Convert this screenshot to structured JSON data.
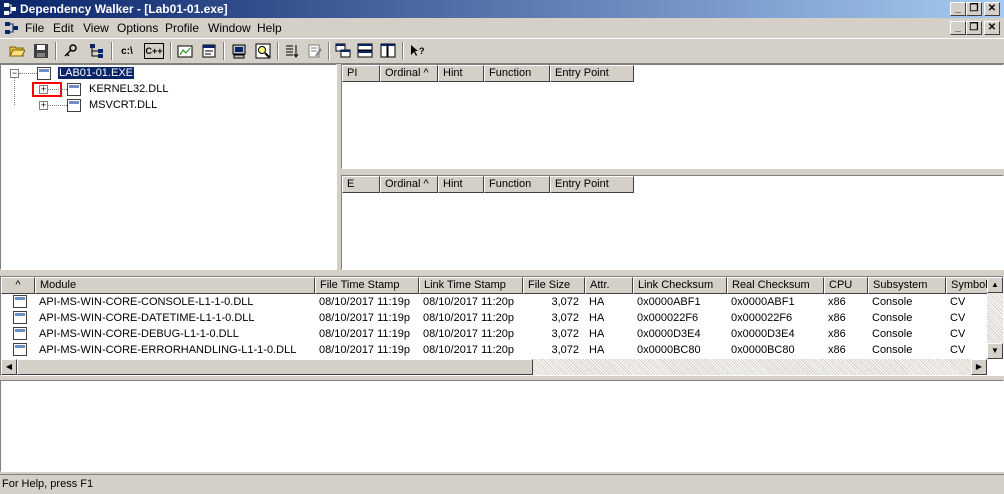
{
  "window": {
    "title": "Dependency Walker - [Lab01-01.exe]",
    "minimize_glyph": "_",
    "restore_glyph": "❐",
    "close_glyph": "✕"
  },
  "menu": [
    "File",
    "Edit",
    "View",
    "Options",
    "Profile",
    "Window",
    "Help"
  ],
  "toolbar": {
    "path_button": "c:\\",
    "cpp_button": "C++"
  },
  "tree": {
    "root": "LAB01-01.EXE",
    "children": [
      "KERNEL32.DLL",
      "MSVCRT.DLL"
    ]
  },
  "imports_panel": {
    "columns": [
      "PI",
      "Ordinal ^",
      "Hint",
      "Function",
      "Entry Point"
    ]
  },
  "exports_panel": {
    "columns": [
      "E",
      "Ordinal ^",
      "Hint",
      "Function",
      "Entry Point"
    ]
  },
  "module_list": {
    "columns": [
      "^",
      "Module",
      "File Time Stamp",
      "Link Time Stamp",
      "File Size",
      "Attr.",
      "Link Checksum",
      "Real Checksum",
      "CPU",
      "Subsystem",
      "Symbols"
    ],
    "rows": [
      [
        "API-MS-WIN-CORE-CONSOLE-L1-1-0.DLL",
        "08/10/2017 11:19p",
        "08/10/2017 11:20p",
        "3,072",
        "HA",
        "0x0000ABF1",
        "0x0000ABF1",
        "x86",
        "Console",
        "CV"
      ],
      [
        "API-MS-WIN-CORE-DATETIME-L1-1-0.DLL",
        "08/10/2017 11:19p",
        "08/10/2017 11:20p",
        "3,072",
        "HA",
        "0x000022F6",
        "0x000022F6",
        "x86",
        "Console",
        "CV"
      ],
      [
        "API-MS-WIN-CORE-DEBUG-L1-1-0.DLL",
        "08/10/2017 11:19p",
        "08/10/2017 11:20p",
        "3,072",
        "HA",
        "0x0000D3E4",
        "0x0000D3E4",
        "x86",
        "Console",
        "CV"
      ],
      [
        "API-MS-WIN-CORE-ERRORHANDLING-L1-1-0.DLL",
        "08/10/2017 11:19p",
        "08/10/2017 11:20p",
        "3,072",
        "HA",
        "0x0000BC80",
        "0x0000BC80",
        "x86",
        "Console",
        "CV"
      ]
    ]
  },
  "status": {
    "text": "For Help, press F1"
  },
  "colors": {
    "title_bar_start": "#0a246a",
    "title_bar_end": "#a6caf0",
    "highlight_frame": "#ff0000",
    "window_face": "#d4d0c8"
  }
}
